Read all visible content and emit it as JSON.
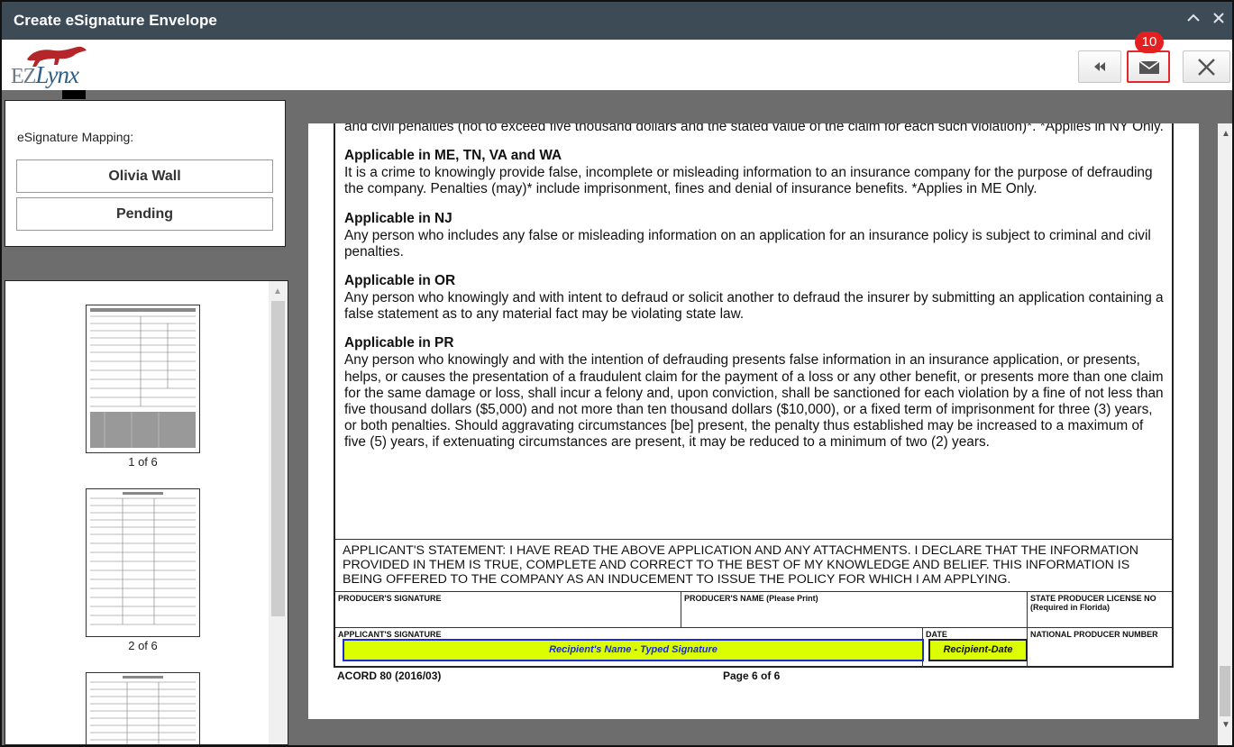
{
  "window": {
    "title": "Create eSignature Envelope",
    "minimize_icon": "chevron-up-icon",
    "close_icon": "close-icon"
  },
  "logo": {
    "prefix": "EZ",
    "text": "Lynx"
  },
  "toolbar": {
    "back_icon": "rewind-icon",
    "send_icon": "envelope-icon",
    "close_icon": "close-icon",
    "badge": "10",
    "highlight_color": "#e3282b",
    "badge_color": "#e31f1f"
  },
  "mapping": {
    "title": "eSignature Mapping:",
    "recipient": "Olivia Wall",
    "status": "Pending"
  },
  "thumbnails": [
    {
      "label": "1 of 6"
    },
    {
      "label": "2 of 6"
    },
    {
      "label": ""
    }
  ],
  "document": {
    "intro": "and civil penalties (not to exceed five thousand dollars and the stated value of the claim for each such violation)*. *Applies in NY Only.",
    "sections": [
      {
        "heading": "Applicable in ME, TN, VA and WA",
        "body": "It is a crime to knowingly provide false, incomplete or misleading information to an insurance company for the purpose of defrauding the company.  Penalties (may)* include imprisonment, fines and denial of insurance benefits. *Applies in ME Only."
      },
      {
        "heading": "Applicable in NJ",
        "body": "Any person who includes any false or misleading information on an application for an insurance policy is subject to criminal and civil penalties."
      },
      {
        "heading": "Applicable in OR",
        "body": "Any person who knowingly and with intent to defraud or solicit another to defraud the insurer by submitting an application containing a false statement as to any material fact may be violating state law."
      },
      {
        "heading": "Applicable in PR",
        "body": "Any person who knowingly and with the intention of defrauding presents false information in an insurance application, or presents, helps, or causes the presentation of a fraudulent claim for the payment of a loss or any other benefit, or presents more than one claim for the same damage or loss, shall incur a felony and, upon conviction, shall be sanctioned for each violation by a fine of not less than five thousand dollars ($5,000) and not more than ten thousand dollars ($10,000), or a fixed term of imprisonment for three (3) years, or both penalties.  Should aggravating circumstances [be] present, the penalty thus established may be increased to a maximum of five (5) years, if extenuating circumstances are present, it may be reduced to a minimum of two (2) years."
      }
    ],
    "statement": "APPLICANT'S STATEMENT:  I HAVE READ THE ABOVE APPLICATION AND ANY ATTACHMENTS. I DECLARE THAT THE INFORMATION PROVIDED IN THEM IS TRUE, COMPLETE AND CORRECT TO THE BEST OF MY KNOWLEDGE AND BELIEF. THIS INFORMATION IS BEING OFFERED TO THE COMPANY AS AN INDUCEMENT TO ISSUE THE POLICY FOR WHICH I AM APPLYING.",
    "fields": {
      "producer_signature": "PRODUCER'S SIGNATURE",
      "producer_name": "PRODUCER'S NAME (Please Print)",
      "license_no": "STATE PRODUCER LICENSE NO (Required in Florida)",
      "applicant_signature": "APPLICANT'S SIGNATURE",
      "date": "DATE",
      "national_producer": "NATIONAL PRODUCER NUMBER"
    },
    "signature_field": "Recipient's Name - Typed Signature",
    "date_field": "Recipient-Date",
    "signature_field_color": "#dcff00",
    "form_id": "ACORD 80 (2016/03)",
    "page_label": "Page 6 of 6"
  }
}
